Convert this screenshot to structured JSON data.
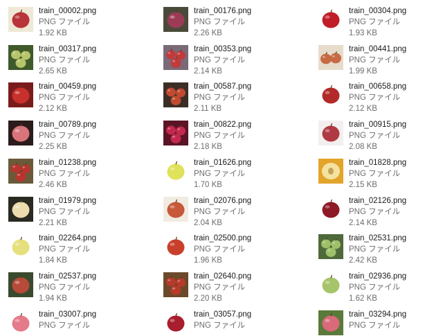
{
  "files": [
    {
      "name": "train_00002.png",
      "type": "PNG ファイル",
      "size": "1.92 KB",
      "thumb": {
        "bg": "#efe8d6",
        "fruit": "#b8343a",
        "shape": "apple"
      }
    },
    {
      "name": "train_00176.png",
      "type": "PNG ファイル",
      "size": "2.26 KB",
      "thumb": {
        "bg": "#4a4a3a",
        "fruit": "#9c3b55",
        "shape": "apple"
      }
    },
    {
      "name": "train_00304.png",
      "type": "PNG ファイル",
      "size": "1.93 KB",
      "thumb": {
        "bg": "#ffffff",
        "fruit": "#c01f2a",
        "shape": "apple"
      }
    },
    {
      "name": "train_00317.png",
      "type": "PNG ファイル",
      "size": "2.65 KB",
      "thumb": {
        "bg": "#3f5a2b",
        "fruit": "#b6c46a",
        "shape": "cluster"
      }
    },
    {
      "name": "train_00353.png",
      "type": "PNG ファイル",
      "size": "2.14 KB",
      "thumb": {
        "bg": "#7a6a78",
        "fruit": "#c23a3a",
        "shape": "cluster"
      }
    },
    {
      "name": "train_00441.png",
      "type": "PNG ファイル",
      "size": "1.99 KB",
      "thumb": {
        "bg": "#e7dccb",
        "fruit": "#c56a44",
        "shape": "pair"
      }
    },
    {
      "name": "train_00459.png",
      "type": "PNG ファイル",
      "size": "2.12 KB",
      "thumb": {
        "bg": "#7a1b1b",
        "fruit": "#c8302c",
        "shape": "apple"
      }
    },
    {
      "name": "train_00587.png",
      "type": "PNG ファイル",
      "size": "2.11 KB",
      "thumb": {
        "bg": "#3a2e26",
        "fruit": "#c04a30",
        "shape": "cluster"
      }
    },
    {
      "name": "train_00658.png",
      "type": "PNG ファイル",
      "size": "2.12 KB",
      "thumb": {
        "bg": "#ffffff",
        "fruit": "#b22a2a",
        "shape": "apple"
      }
    },
    {
      "name": "train_00789.png",
      "type": "PNG ファイル",
      "size": "2.25 KB",
      "thumb": {
        "bg": "#2b1b1b",
        "fruit": "#d9747a",
        "shape": "apple"
      }
    },
    {
      "name": "train_00822.png",
      "type": "PNG ファイル",
      "size": "2.18 KB",
      "thumb": {
        "bg": "#5a1426",
        "fruit": "#c4284e",
        "shape": "cluster"
      }
    },
    {
      "name": "train_00915.png",
      "type": "PNG ファイル",
      "size": "2.08 KB",
      "thumb": {
        "bg": "#f3efef",
        "fruit": "#b03a44",
        "shape": "apple"
      }
    },
    {
      "name": "train_01238.png",
      "type": "PNG ファイル",
      "size": "2.46 KB",
      "thumb": {
        "bg": "#6a5a3a",
        "fruit": "#b8342e",
        "shape": "cluster"
      }
    },
    {
      "name": "train_01626.png",
      "type": "PNG ファイル",
      "size": "1.70 KB",
      "thumb": {
        "bg": "#ffffff",
        "fruit": "#dfe25a",
        "shape": "apple"
      }
    },
    {
      "name": "train_01828.png",
      "type": "PNG ファイル",
      "size": "2.15 KB",
      "thumb": {
        "bg": "#e3a42a",
        "fruit": "#f4e2a0",
        "shape": "half"
      }
    },
    {
      "name": "train_01979.png",
      "type": "PNG ファイル",
      "size": "2.21 KB",
      "thumb": {
        "bg": "#2a2a22",
        "fruit": "#ecdcae",
        "shape": "apple"
      }
    },
    {
      "name": "train_02076.png",
      "type": "PNG ファイル",
      "size": "2.04 KB",
      "thumb": {
        "bg": "#f1ebe2",
        "fruit": "#c7583a",
        "shape": "apple"
      }
    },
    {
      "name": "train_02126.png",
      "type": "PNG ファイル",
      "size": "2.14 KB",
      "thumb": {
        "bg": "#ffffff",
        "fruit": "#8e1a26",
        "shape": "apple"
      }
    },
    {
      "name": "train_02264.png",
      "type": "PNG ファイル",
      "size": "1.84 KB",
      "thumb": {
        "bg": "#ffffff",
        "fruit": "#e6e07c",
        "shape": "apple"
      }
    },
    {
      "name": "train_02500.png",
      "type": "PNG ファイル",
      "size": "1.96 KB",
      "thumb": {
        "bg": "#ffffff",
        "fruit": "#c8402c",
        "shape": "apple"
      }
    },
    {
      "name": "train_02531.png",
      "type": "PNG ファイル",
      "size": "2.42 KB",
      "thumb": {
        "bg": "#4f6a3a",
        "fruit": "#9fc06a",
        "shape": "cluster"
      }
    },
    {
      "name": "train_02537.png",
      "type": "PNG ファイル",
      "size": "1.94 KB",
      "thumb": {
        "bg": "#3a4a2e",
        "fruit": "#b84a3a",
        "shape": "apple"
      }
    },
    {
      "name": "train_02640.png",
      "type": "PNG ファイル",
      "size": "2.20 KB",
      "thumb": {
        "bg": "#6a4a2a",
        "fruit": "#b83a2a",
        "shape": "cluster"
      }
    },
    {
      "name": "train_02936.png",
      "type": "PNG ファイル",
      "size": "1.62 KB",
      "thumb": {
        "bg": "#ffffff",
        "fruit": "#a6c46a",
        "shape": "apple"
      }
    },
    {
      "name": "train_03007.png",
      "type": "PNG ファイル",
      "size": "",
      "thumb": {
        "bg": "#ffffff",
        "fruit": "#e57a8a",
        "shape": "apple"
      }
    },
    {
      "name": "train_03057.png",
      "type": "PNG ファイル",
      "size": "",
      "thumb": {
        "bg": "#ffffff",
        "fruit": "#a81e2e",
        "shape": "apple"
      }
    },
    {
      "name": "train_03294.png",
      "type": "PNG ファイル",
      "size": "",
      "thumb": {
        "bg": "#5a7a3a",
        "fruit": "#d86a7a",
        "shape": "apple"
      }
    }
  ]
}
